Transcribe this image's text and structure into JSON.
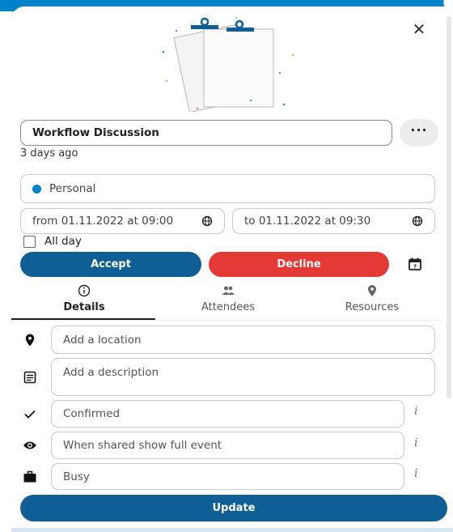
{
  "event": {
    "title": "Workflow Discussion",
    "modified_ago": "3 days ago",
    "calendar_name": "Personal",
    "calendar_color": "#0082c9",
    "from_label": "from 01.11.2022 at 09:00",
    "to_label": "to 01.11.2022 at 09:30",
    "all_day_label": "All day",
    "all_day": false
  },
  "actions": {
    "accept_label": "Accept",
    "decline_label": "Decline",
    "more_label": "···",
    "update_label": "Update",
    "accept_color": "#0f5f96",
    "decline_color": "#e53935"
  },
  "tabs": [
    {
      "label": "Details",
      "icon": "info-icon",
      "active": true
    },
    {
      "label": "Attendees",
      "icon": "people-icon",
      "active": false
    },
    {
      "label": "Resources",
      "icon": "map-pin-icon",
      "active": false
    }
  ],
  "details": {
    "location_placeholder": "Add a location",
    "description_placeholder": "Add a description",
    "status_value": "Confirmed",
    "visibility_value": "When shared show full event",
    "busy_value": "Busy",
    "info_glyph": "i"
  },
  "icons": {
    "close": "close-icon",
    "globe": "globe-icon",
    "calendar": "calendar-icon",
    "location": "location-pin-icon",
    "description": "text-notes-icon",
    "status": "check-icon",
    "visibility": "eye-icon",
    "busy": "briefcase-icon"
  }
}
